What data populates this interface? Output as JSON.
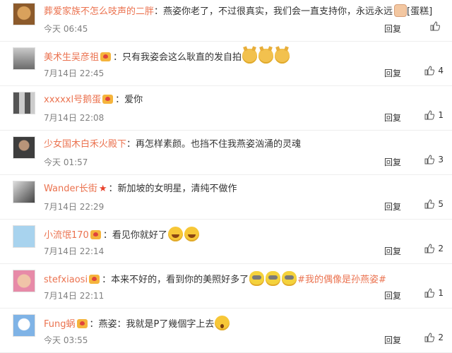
{
  "reply_label": "回复",
  "comments": [
    {
      "avatar": "hamster",
      "user": "葬爱家族不怎么吱声的二胖",
      "vip": false,
      "text": "：燕姿你老了，不过很真实，我们会一直支持你，永远永远",
      "suffix": "[蛋糕]",
      "emojis": [
        "thumbs-up"
      ],
      "time": "今天 06:45",
      "likes": ""
    },
    {
      "avatar": "man-portrait",
      "user": "美术生吴彦祖",
      "vip": true,
      "text": "：只有我姿会这么耿直的发自拍",
      "emojis": [
        "doge",
        "doge",
        "doge"
      ],
      "time": "7月14日 22:45",
      "likes": "4"
    },
    {
      "avatar": "collage",
      "user": "xxxxxl号鹅蛋",
      "vip": true,
      "text": "：爱你",
      "emojis": [],
      "time": "7月14日 22:08",
      "likes": "1"
    },
    {
      "avatar": "person",
      "user": "少女国木白禾火殿下",
      "vip": false,
      "text": "：再怎样素颜。也挡不住我燕姿汹涌的灵魂",
      "emojis": [],
      "time": "今天 01:57",
      "likes": "3"
    },
    {
      "avatar": "dark",
      "user": "Wander长街",
      "vip": false,
      "star": true,
      "text": "：新加坡的女明星，清纯不做作",
      "emojis": [],
      "time": "7月14日 22:29",
      "likes": "5"
    },
    {
      "avatar": "blue",
      "user": "小流氓170",
      "vip": true,
      "text": "：看见你就好了",
      "emojis": [
        "happy",
        "happy"
      ],
      "time": "7月14日 22:14",
      "likes": "2"
    },
    {
      "avatar": "child",
      "user": "stefxiaosi",
      "vip": true,
      "text": "：本来不好的，看到你的美照好多了",
      "emojis": [
        "minion",
        "minion",
        "minion"
      ],
      "hashtag": "#我的偶像是孙燕姿#",
      "time": "7月14日 22:11",
      "likes": "1"
    },
    {
      "avatar": "cartoon",
      "user": "Fung蜗",
      "vip": true,
      "text": "：燕姿：我就是P了幾個字上去",
      "emojis": [
        "wow"
      ],
      "time": "今天 03:55",
      "likes": "2"
    }
  ],
  "colors": {
    "username": "#eb7350",
    "time": "#808080",
    "divider": "#eeeeee"
  }
}
